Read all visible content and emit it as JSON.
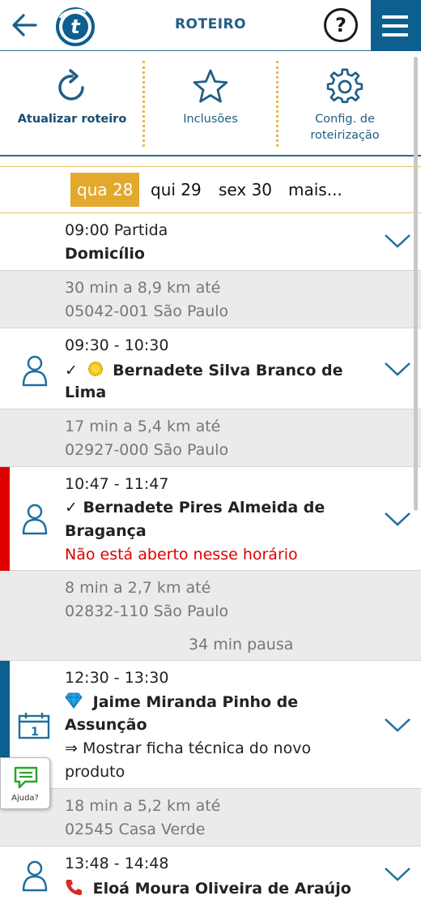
{
  "header": {
    "title": "ROTEIRO",
    "help_label": "?",
    "logo_letter": "t"
  },
  "actions": [
    {
      "label": "Atualizar roteiro",
      "icon": "refresh-icon"
    },
    {
      "label": "Inclusões",
      "icon": "star-icon"
    },
    {
      "label_line1": "Config. de",
      "label_line2": "roteirização",
      "icon": "gear-icon"
    }
  ],
  "days": {
    "active": "qua 28",
    "items": [
      "qui 29",
      "sex 30",
      "mais..."
    ]
  },
  "schedule": {
    "start": {
      "time": "09:00 Partida",
      "place": "Domicílio"
    },
    "travel1": {
      "line1": "30 min a 8,9 km até",
      "line2": "05042-001 São Paulo"
    },
    "visit1": {
      "time": "09:30 - 10:30",
      "name_line1": "Bernadete Silva Branco de",
      "name_line2": "Lima",
      "check": "✓"
    },
    "travel2": {
      "line1": "17 min a 5,4 km até",
      "line2": "02927-000 São Paulo"
    },
    "visit2": {
      "time": "10:47 - 11:47",
      "name_line1": "Bernadete Pires Almeida de",
      "name_line2": "Bragança",
      "warning": "Não está aberto nesse horário",
      "check": "✓"
    },
    "travel3": {
      "line1": "8 min a 2,7 km até",
      "line2": "02832-110 São Paulo",
      "pause": "34 min pausa"
    },
    "visit3": {
      "time": "12:30 - 13:30",
      "name_line1": "Jaime Miranda Pinho de",
      "name_line2": "Assunção",
      "note_line1": "⇒ Mostrar ficha técnica do novo",
      "note_line2": "produto"
    },
    "travel4": {
      "line1": "18 min a 5,2 km até",
      "line2": "02545 Casa Verde"
    },
    "visit4": {
      "time": "13:48 - 14:48",
      "name": "Eloá Moura Oliveira de Araújo"
    }
  },
  "help_fab": {
    "label": "Ajuda?"
  },
  "colors": {
    "primary": "#0d5f8f",
    "accent": "#e3a92d",
    "alert": "#e00000"
  }
}
